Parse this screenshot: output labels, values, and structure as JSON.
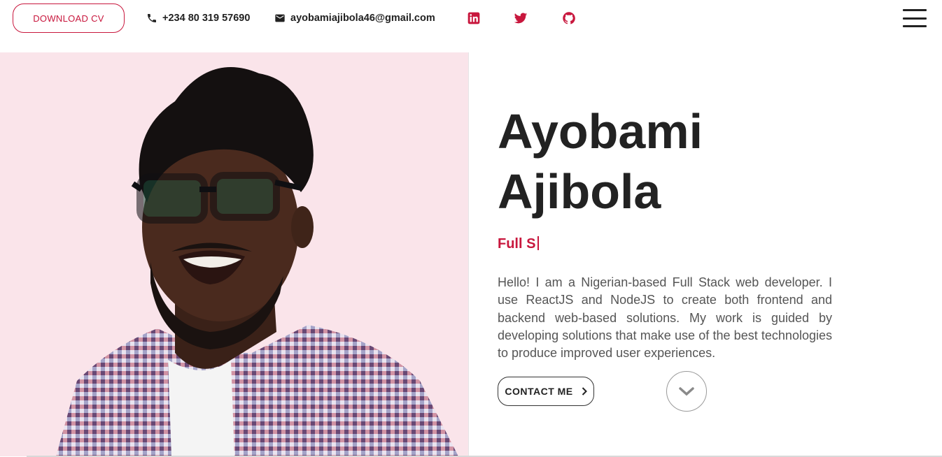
{
  "header": {
    "download_cv_label": "DOWNLOAD CV",
    "phone": "+234 80 319 57690",
    "email": "ayobamiajibola46@gmail.com",
    "social": [
      {
        "icon": "linkedin-icon"
      },
      {
        "icon": "twitter-icon"
      },
      {
        "icon": "github-icon"
      }
    ],
    "menu_icon": "hamburger-menu-icon"
  },
  "hero": {
    "first_name": "Ayobami",
    "last_name": "Ajibola",
    "typed_role": "Full S",
    "bio": "Hello! I am a Nigerian-based Full Stack web developer. I use ReactJS and NodeJS to create both frontend and backend web-based solutions. My work is guided by developing solutions that make use of the best technologies to produce improved user experiences.",
    "contact_label": "CONTACT ME",
    "scroll_icon": "chevron-down-icon"
  },
  "colors": {
    "accent": "#c8173d",
    "photo_background": "#fae4ea",
    "text_dark": "#222222",
    "text_body": "#555555"
  }
}
